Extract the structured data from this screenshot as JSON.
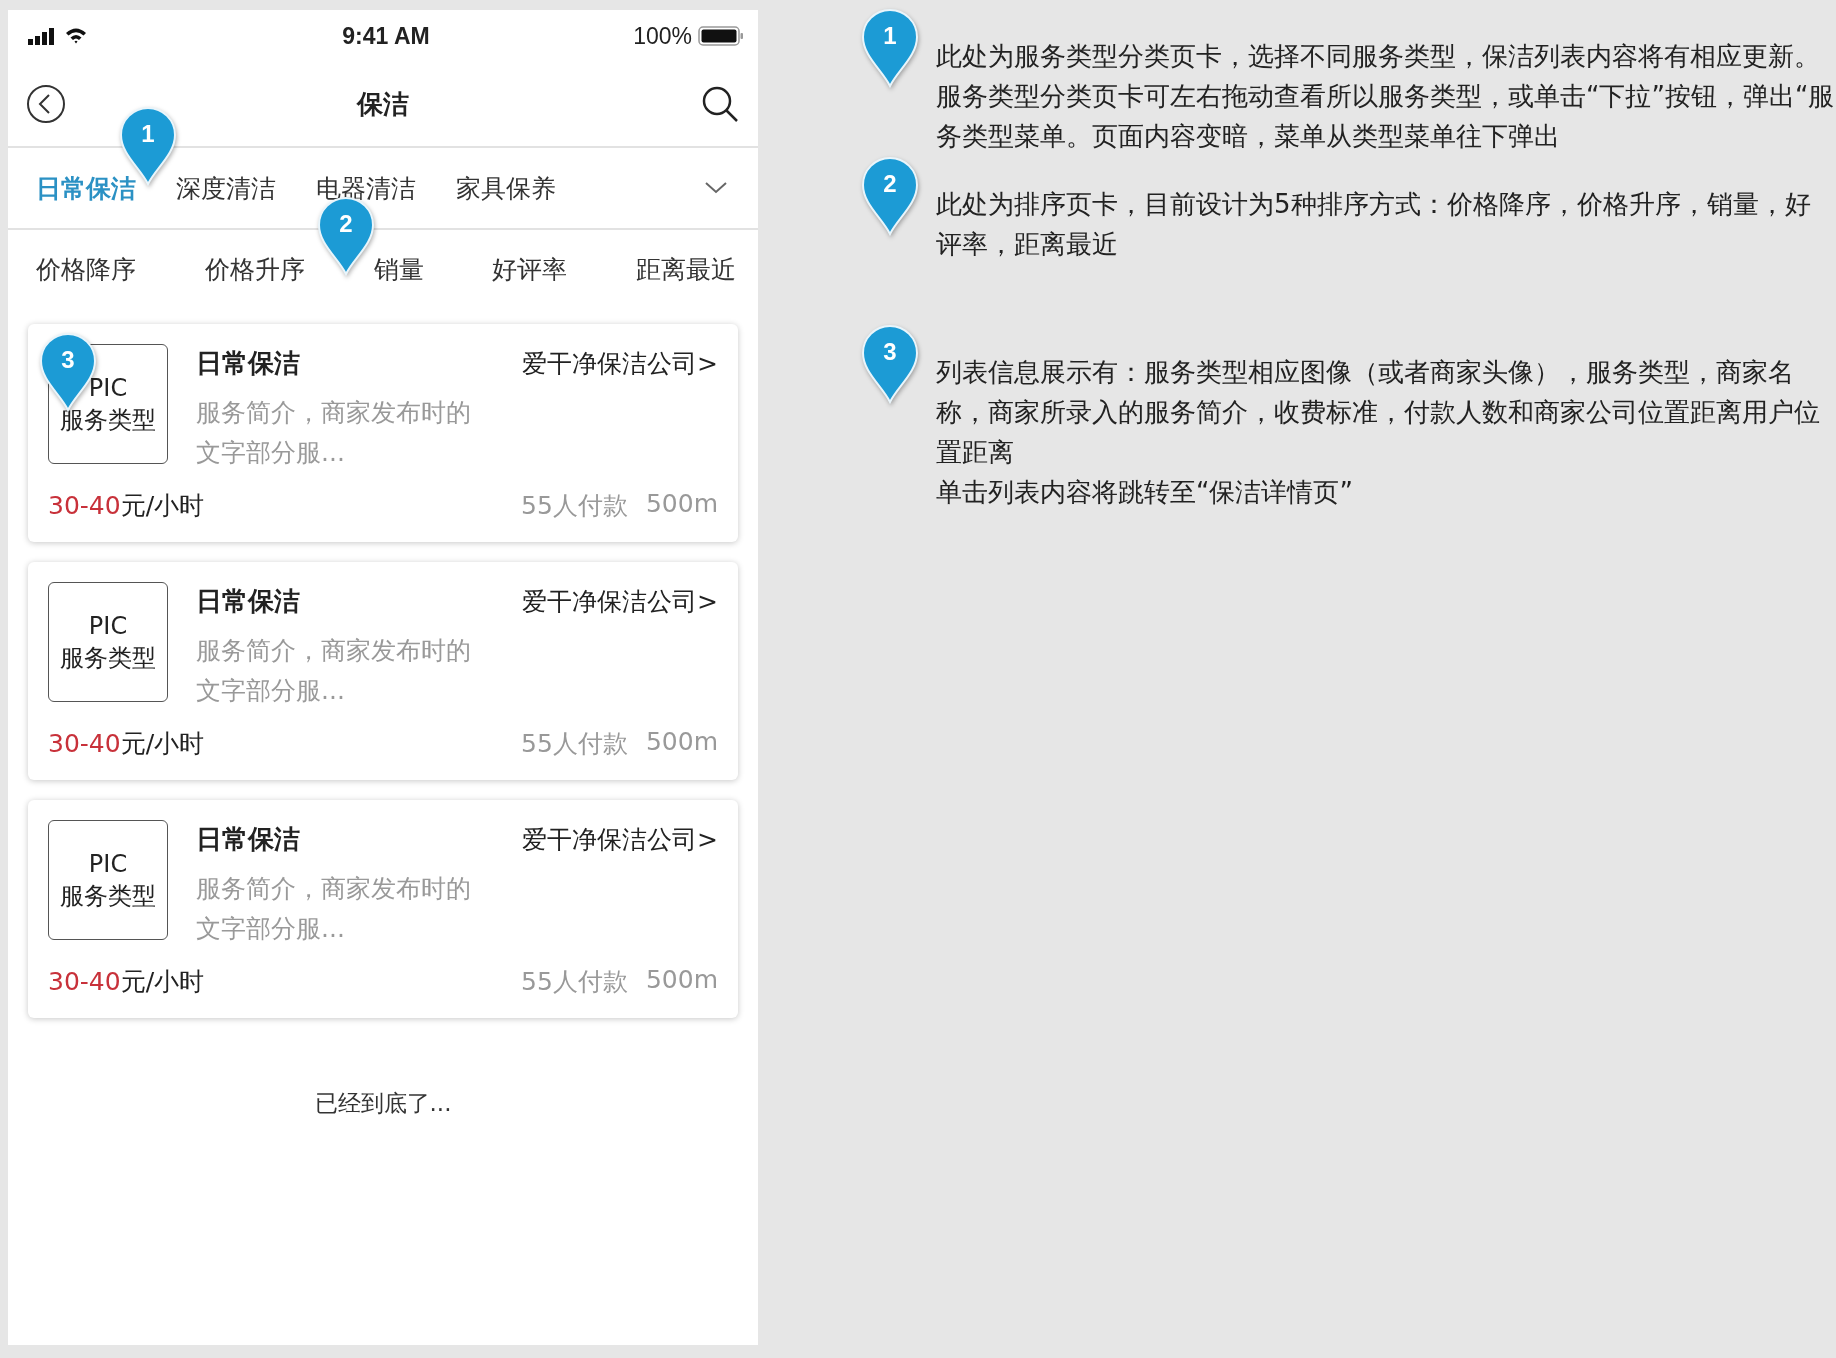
{
  "status_bar": {
    "time": "9:41 AM",
    "battery": "100%"
  },
  "nav": {
    "title": "保洁"
  },
  "category_tabs": [
    {
      "label": "日常保洁",
      "selected": true
    },
    {
      "label": "深度清洁",
      "selected": false
    },
    {
      "label": "电器清洁",
      "selected": false
    },
    {
      "label": "家具保养",
      "selected": false
    }
  ],
  "sort_tabs": [
    "价格降序",
    "价格升序",
    "销量",
    "好评率",
    "距离最近"
  ],
  "listings": [
    {
      "pic_label": "PIC",
      "pic_caption": "服务类型",
      "title": "日常保洁",
      "company": "爱干净保洁公司>",
      "description": "服务简介，商家发布时的文字部分服...",
      "price_range": "30-40",
      "price_unit": "元/小时",
      "payers": "55人付款",
      "distance": "500m"
    },
    {
      "pic_label": "PIC",
      "pic_caption": "服务类型",
      "title": "日常保洁",
      "company": "爱干净保洁公司>",
      "description": "服务简介，商家发布时的文字部分服...",
      "price_range": "30-40",
      "price_unit": "元/小时",
      "payers": "55人付款",
      "distance": "500m"
    },
    {
      "pic_label": "PIC",
      "pic_caption": "服务类型",
      "title": "日常保洁",
      "company": "爱干净保洁公司>",
      "description": "服务简介，商家发布时的文字部分服...",
      "price_range": "30-40",
      "price_unit": "元/小时",
      "payers": "55人付款",
      "distance": "500m"
    }
  ],
  "end_note": "已经到底了...",
  "callouts": [
    "1",
    "2",
    "3"
  ],
  "notes": [
    {
      "number": "1",
      "paragraphs": [
        "此处为服务类型分类页卡，选择不同服务类型，保洁列表内容将有相应更新。",
        "服务类型分类页卡可左右拖动查看所以服务类型，或单击“下拉”按钮，弹出“服务类型菜单。页面内容变暗，菜单从类型菜单往下弹出"
      ]
    },
    {
      "number": "2",
      "paragraphs": [
        "此处为排序页卡，目前设计为5种排序方式：价格降序，价格升序，销量，好评率，距离最近"
      ]
    },
    {
      "number": "3",
      "paragraphs": [
        "列表信息展示有：服务类型相应图像（或者商家头像），服务类型，商家名称，商家所录入的服务简介，收费标准，付款人数和商家公司位置距离用户位置距离",
        "单击列表内容将跳转至“保洁详情页”"
      ]
    }
  ]
}
